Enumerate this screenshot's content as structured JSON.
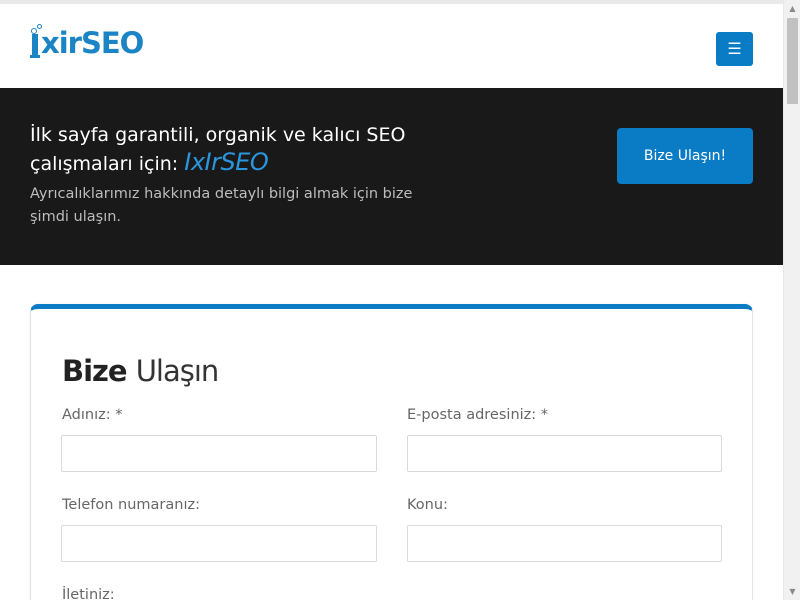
{
  "header": {
    "logo_text": "xirSEO",
    "menu_icon": "☰"
  },
  "hero": {
    "title_line": "İlk sayfa garantili, organik ve kalıcı SEO çalışmaları için:",
    "brand": "IxIrSEO",
    "subtitle": " Ayrıcalıklarımız hakkında detaylı bilgi almak için bize şimdi ulaşın.",
    "cta_label": "Bize Ulaşın!"
  },
  "contact": {
    "title_strong": "Bize",
    "title_light": "Ulaşın",
    "name_label": "Adınız: *",
    "email_label": "E-posta adresiniz: *",
    "phone_label": "Telefon numaranız:",
    "subject_label": "Konu:",
    "message_label": "İletiniz:",
    "name_value": "",
    "email_value": "",
    "phone_value": "",
    "subject_value": ""
  },
  "colors": {
    "accent": "#0a7cc5",
    "hero_bg": "#191919"
  }
}
